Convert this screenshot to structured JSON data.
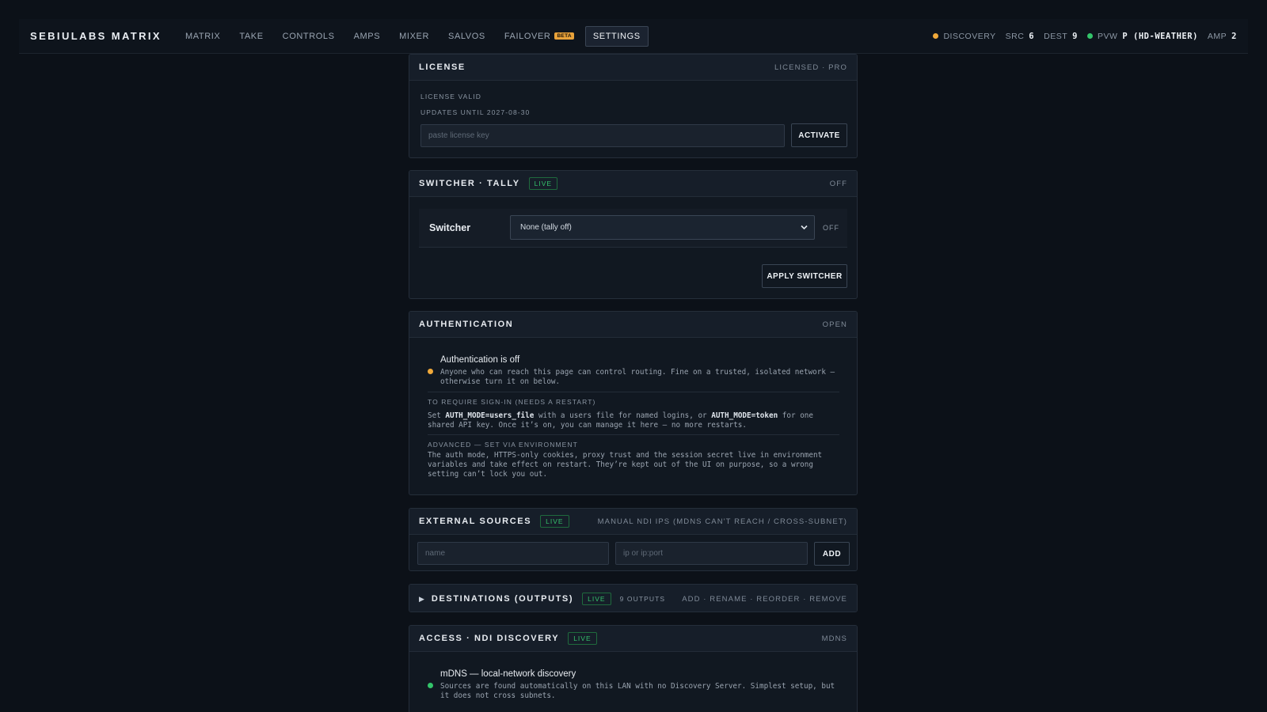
{
  "app": {
    "title": "SEBIULABS MATRIX"
  },
  "nav": {
    "items": [
      {
        "label": "MATRIX"
      },
      {
        "label": "TAKE"
      },
      {
        "label": "CONTROLS"
      },
      {
        "label": "AMPS"
      },
      {
        "label": "MIXER"
      },
      {
        "label": "SALVOS"
      },
      {
        "label": "FAILOVER",
        "badge": "BETA"
      },
      {
        "label": "SETTINGS",
        "active": true
      }
    ]
  },
  "status": {
    "discovery_label": "DISCOVERY",
    "src_label": "SRC",
    "src_value": "6",
    "dest_label": "DEST",
    "dest_value": "9",
    "pvw_label": "PVW",
    "pvw_value": "P (HD-WEATHER)",
    "amp_label": "AMP",
    "amp_value": "2",
    "colors": {
      "discovery": "#f0a93a",
      "pvw": "#33c46a"
    }
  },
  "license": {
    "title": "LICENSE",
    "status": "LICENSED · PRO",
    "valid_text": "LICENSE VALID",
    "updates_text": "UPDATES UNTIL 2027-08-30",
    "key_placeholder": "paste license key",
    "activate_label": "ACTIVATE"
  },
  "switcher": {
    "title": "SWITCHER · TALLY",
    "live_badge": "LIVE",
    "status": "OFF",
    "row_label": "Switcher",
    "selected": "None (tally off)",
    "row_status": "OFF",
    "apply_label": "APPLY SWITCHER"
  },
  "auth": {
    "title": "AUTHENTICATION",
    "status": "OPEN",
    "notice_title": "Authentication is off",
    "notice_body": "Anyone who can reach this page can control routing. Fine on a trusted, isolated network — otherwise turn it on below.",
    "require_heading": "TO REQUIRE SIGN-IN (NEEDS A RESTART)",
    "require_pre": "Set ",
    "require_code1": "AUTH_MODE=users_file",
    "require_mid": " with a users file for named logins, or ",
    "require_code2": "AUTH_MODE=token",
    "require_post": " for one shared API key. Once it’s on, you can manage it here — no more restarts.",
    "advanced_heading": "ADVANCED — SET VIA ENVIRONMENT",
    "advanced_body": "The auth mode, HTTPS-only cookies, proxy trust and the session secret live in environment variables and take effect on restart. They’re kept out of the UI on purpose, so a wrong setting can’t lock you out.",
    "dot_color": "#f0a93a"
  },
  "external": {
    "title": "EXTERNAL SOURCES",
    "live_badge": "LIVE",
    "note": "MANUAL NDI IPS (MDNS CAN'T REACH / CROSS-SUBNET)",
    "name_placeholder": "name",
    "ip_placeholder": "ip or ip:port",
    "add_label": "ADD"
  },
  "destinations": {
    "arrow": "▶",
    "title": "DESTINATIONS (OUTPUTS)",
    "live_badge": "LIVE",
    "count": "9 OUTPUTS",
    "actions": "ADD · RENAME · REORDER · REMOVE"
  },
  "access": {
    "title": "ACCESS · NDI DISCOVERY",
    "live_badge": "LIVE",
    "mode": "MDNS",
    "option_title": "mDNS — local-network discovery",
    "option_body": "Sources are found automatically on this LAN with no Discovery Server. Simplest setup, but it does not cross subnets.",
    "dot_color": "#33c46a"
  }
}
